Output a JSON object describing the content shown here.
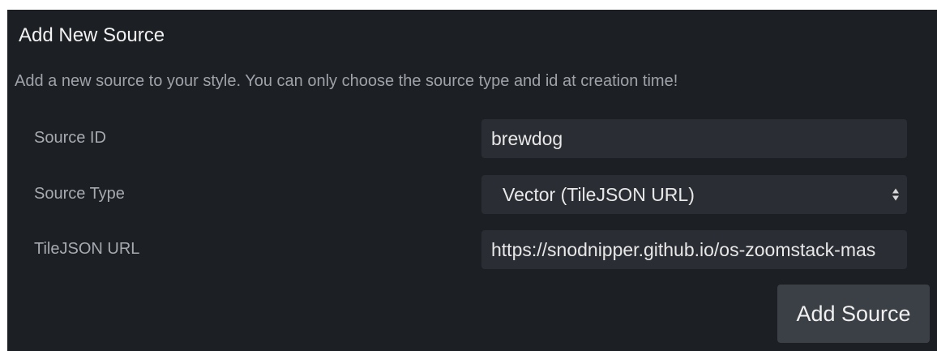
{
  "dialog": {
    "title": "Add New Source",
    "description": "Add a new source to your style. You can only choose the source type and id at creation time!"
  },
  "form": {
    "source_id": {
      "label": "Source ID",
      "value": "brewdog"
    },
    "source_type": {
      "label": "Source Type",
      "selected": "Vector (TileJSON URL)"
    },
    "tilejson_url": {
      "label": "TileJSON URL",
      "value": "https://snodnipper.github.io/os-zoomstack-mas"
    }
  },
  "actions": {
    "add_source_label": "Add Source"
  },
  "colors": {
    "panel_bg": "#1c1f24",
    "field_bg": "#2a2d33",
    "button_bg": "#3b3f46",
    "label_text": "#a7aab0",
    "value_text": "#e8e8e8"
  },
  "icons": {
    "select_arrows": "up-down-arrows-icon"
  }
}
